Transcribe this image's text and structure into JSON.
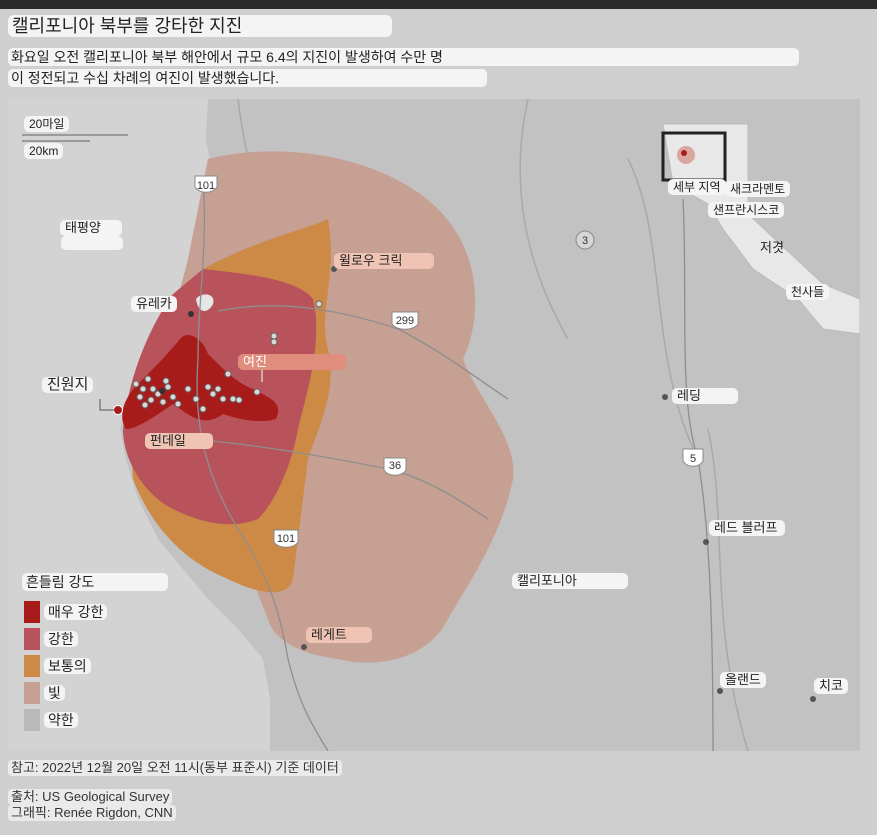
{
  "title": "캘리포니아 북부를 강타한 지진",
  "subtitle_line1": "화요일 오전 캘리포니아 북부 해안에서 규모 6.4의 지진이 발생하여 수만 명",
  "subtitle_line2": "이 정전되고 수십 차례의 여진이 발생했습니다.",
  "scale": {
    "miles": "20마일",
    "km": "20km"
  },
  "places": {
    "pacific": "태평양",
    "eureka": "유레카",
    "willow_creek": "윌로우 크릭",
    "epicenter": "진원지",
    "aftershocks": "여진",
    "ferndale": "펀데일",
    "redding": "레딩",
    "red_bluff": "레드 블러프",
    "california": "캘리포니아",
    "leggett": "레게트",
    "orland": "올랜드",
    "chico": "치코"
  },
  "highways": [
    "101",
    "3",
    "299",
    "36",
    "5",
    "101"
  ],
  "inset": {
    "label_north": "세부 지역",
    "sacramento": "새크라멘토",
    "san_francisco": "샌프란시스코",
    "bay": "저겻",
    "los_angeles": "천사들"
  },
  "legend": {
    "title": "흔들림 강도",
    "items": [
      {
        "label": "매우 강한",
        "color": "#a81b1b"
      },
      {
        "label": "강한",
        "color": "#b8535b"
      },
      {
        "label": "보통의",
        "color": "#cd8a46"
      },
      {
        "label": "빛",
        "color": "#c7a094"
      },
      {
        "label": "약한",
        "color": "#b9b9b9"
      }
    ]
  },
  "note": "참고: 2022년 12월 20일 오전 11시(동부 표준시) 기준 데이터",
  "source": "출처: US Geological Survey",
  "graphic": "그래픽: Renée Rigdon, CNN"
}
